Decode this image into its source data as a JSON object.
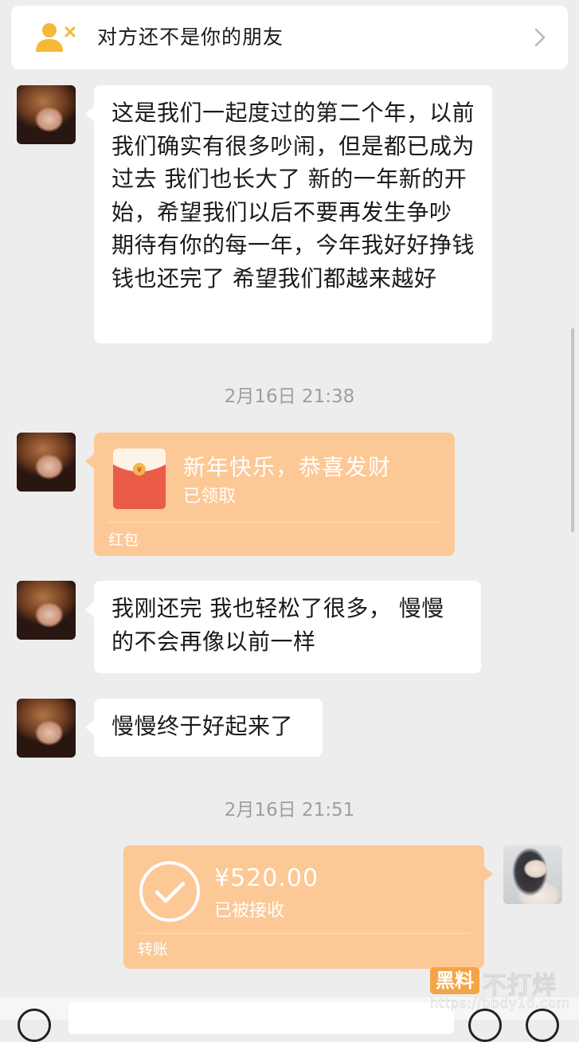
{
  "banner": {
    "icon": "user-remove-icon",
    "text": "对方还不是你的朋友",
    "chevron": "chevron-right-icon"
  },
  "messages": [
    {
      "text": "这是我们一起度过的第二个年，以前我们确实有很多吵闹，但是都已成为过去 我们也长大了 新的一年新的开始，希望我们以后不要再发生争吵 期待有你的每一年，今年我好好挣钱 钱也还完了 希望我们都越来越好"
    },
    {
      "text": "我刚还完 我也轻松了很多， 慢慢的不会再像以前一样"
    },
    {
      "text": "慢慢终于好起来了"
    }
  ],
  "timestamps": [
    "2月16日 21:38",
    "2月16日 21:51"
  ],
  "red_packet": {
    "title": "新年快乐，恭喜发财",
    "status": "已领取",
    "type": "红包",
    "icon": "red-envelope-icon",
    "color": "#fcc896"
  },
  "transfer": {
    "amount": "¥520.00",
    "status": "已被接收",
    "type": "转账",
    "icon": "check-circle-icon",
    "color": "#fcc896"
  },
  "watermark": {
    "badge": "黑料",
    "name": "不打烊",
    "url": "https://bbdy16.com"
  }
}
